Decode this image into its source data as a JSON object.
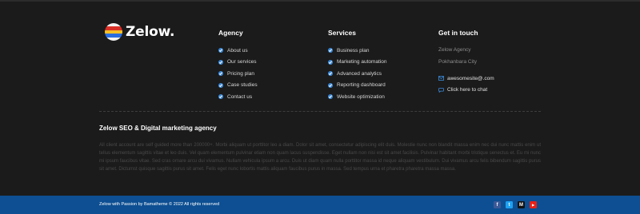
{
  "brand": {
    "name": "Zelow.",
    "logo_colors": [
      "#f2f2f2",
      "#d93025",
      "#f6c026",
      "#2a6de0",
      "#f2f2f2"
    ]
  },
  "agency": {
    "heading": "Agency",
    "links": [
      "About us",
      "Our services",
      "Pricing plan",
      "Case studies",
      "Contact us"
    ]
  },
  "services": {
    "heading": "Services",
    "links": [
      "Business plan",
      "Marketing automation",
      "Advanced analytics",
      "Reporting dashboard",
      "Website optimization"
    ]
  },
  "contact": {
    "heading": "Get in touch",
    "company": "Zelow Agency",
    "city": "Pokhanbara City",
    "email": "awesomesite@.com",
    "chat": "Click here to chat",
    "email_icon": "mail-icon",
    "chat_icon": "chat-bubble-icon"
  },
  "about": {
    "title": "Zelow SEO & Digital marketing agency",
    "body": "All client account are self guided more than 200000+. Morbi aliquam ut porttitor leo a diam. Dolor sit amet, consectetur adipiscing elit duis. Molestie nunc non blandit massa enim nec dui nunc mattis enim ut tellus elementum sagittis vitae et leo duis. Vel quam elementum pulvinar etiam non quam lacus suspendisse. Eget nullam non nisi est sit amet facilisis. Pulvinar habitant morbi tristique senectus et. Eu mi nunc mi ipsum faucibus vitae. Sed cras ornare arcu dui vivamus. Nullam vehicula ipsum a arcu. Duis ut diam quam nulla porttitor massa id neque aliquam vestibulum. Dui vivamus arcu felis bibendum sagittis purus sit amet. Dictumst quisque sagittis purus sit amet. Felis eget nunc lobortis mattis aliquam faucibus purus in massa. Sed tempus urna et pharetra pharetra massa massa."
  },
  "footer": {
    "copyright": "Zelow with Passion by Bamatheme © 2022 All rights reserved",
    "socials": [
      {
        "name": "facebook-icon",
        "glyph": "f",
        "color": "#3b5998"
      },
      {
        "name": "twitter-icon",
        "glyph": "t",
        "color": "#1da1f2"
      },
      {
        "name": "medium-icon",
        "glyph": "M",
        "color": "#111111"
      },
      {
        "name": "youtube-icon",
        "glyph": "▶",
        "color": "#e62117"
      }
    ]
  }
}
